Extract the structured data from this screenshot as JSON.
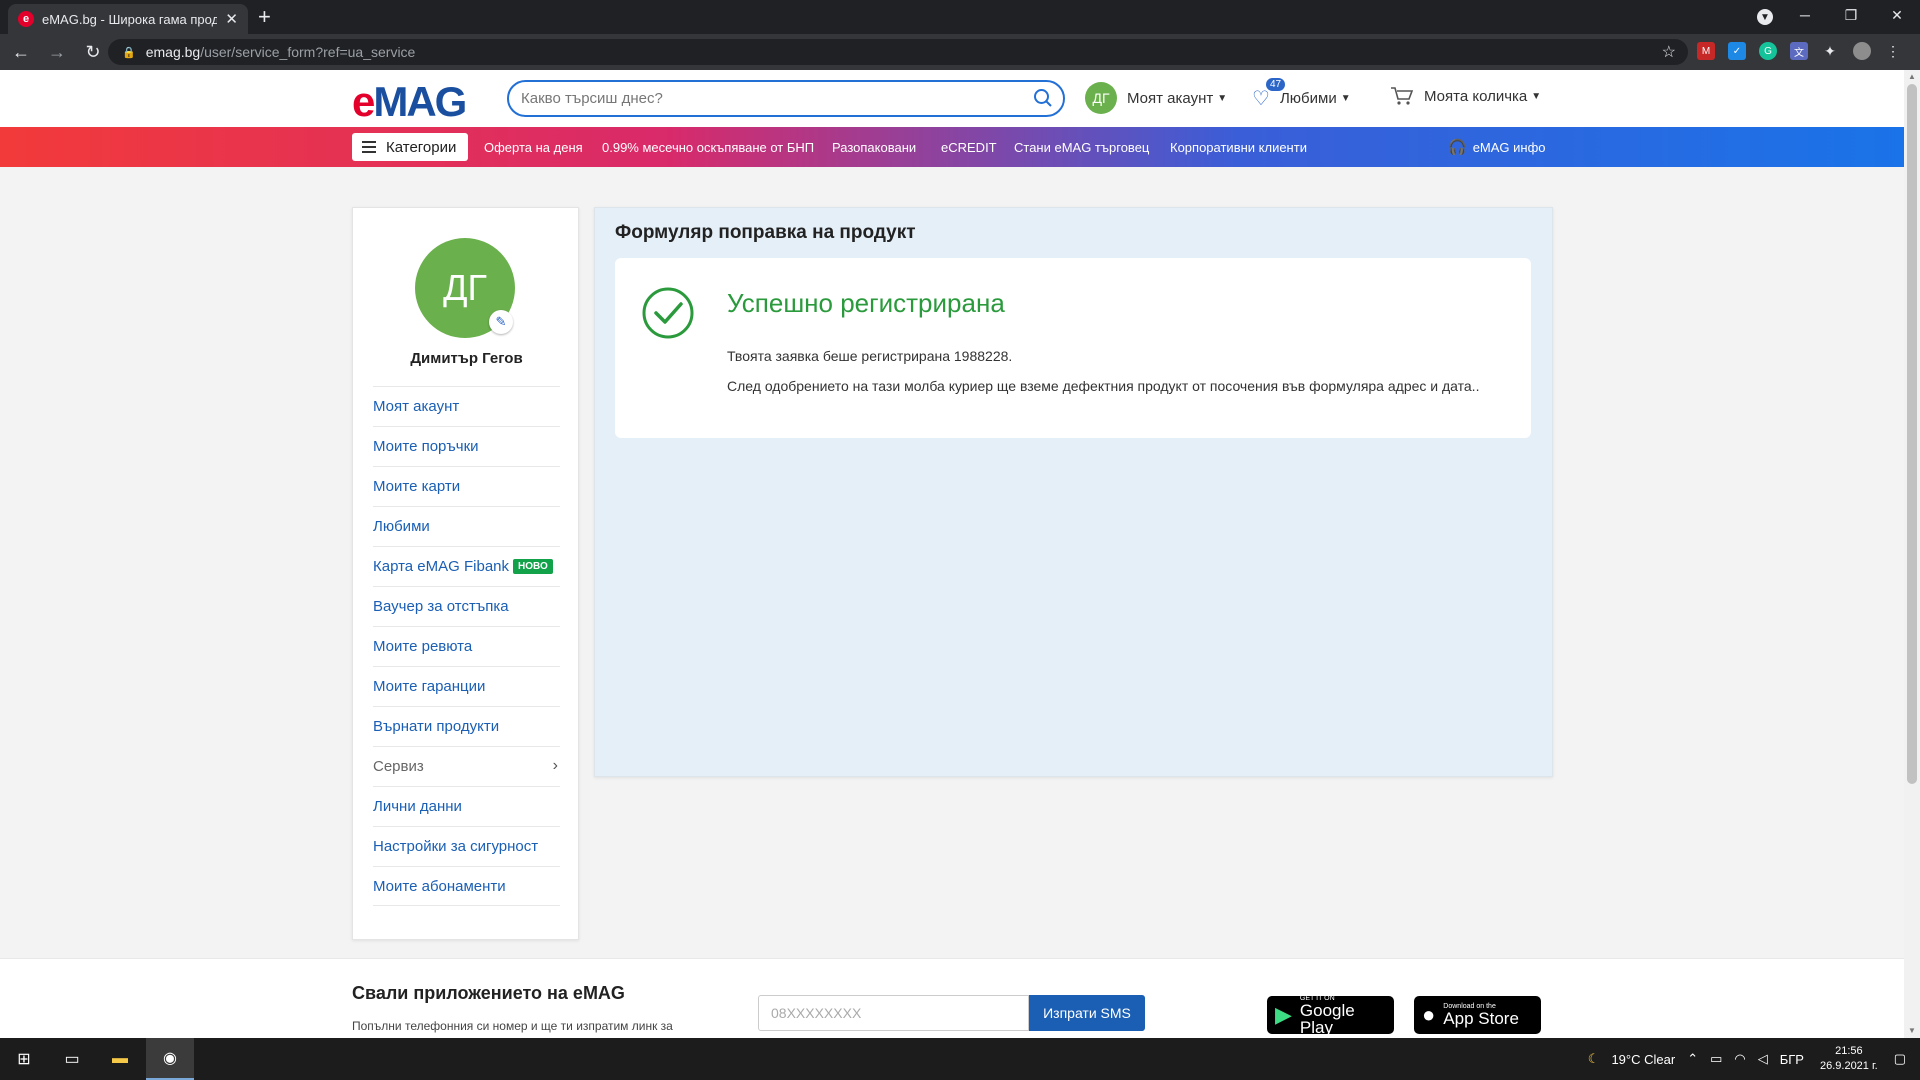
{
  "browser": {
    "tab_title": "eMAG.bg - Широка гама проду",
    "tab_favicon": "e",
    "new_tab_symbol": "+",
    "url_host": "emag.bg",
    "url_path": "/user/service_form?ref=ua_service"
  },
  "header": {
    "logo_e": "e",
    "logo_rest": "MAG",
    "search_placeholder": "Какво търсиш днес?",
    "account_initials": "ДГ",
    "account_label": "Моят акаунт",
    "favorites_label": "Любими",
    "favorites_count": "47",
    "cart_label": "Моята количка"
  },
  "navbar": {
    "categories": "Категории",
    "links": [
      "Оферта на деня",
      "0.99% месечно оскъпяване от БНП",
      "Разопаковани",
      "eCREDIT",
      "Стани eMAG търговец",
      "Корпоративни клиенти"
    ],
    "info": "eMAG инфо"
  },
  "sidebar": {
    "initials": "ДГ",
    "user_name": "Димитър Гегов",
    "items": [
      {
        "label": "Моят акаунт"
      },
      {
        "label": "Моите поръчки"
      },
      {
        "label": "Моите карти"
      },
      {
        "label": "Любими"
      },
      {
        "label": "Карта eMAG Fibank",
        "badge": "НОВО"
      },
      {
        "label": "Ваучер за отстъпка"
      },
      {
        "label": "Моите ревюта"
      },
      {
        "label": "Моите гаранции"
      },
      {
        "label": "Върнати продукти"
      },
      {
        "label": "Сервиз"
      },
      {
        "label": "Лични данни"
      },
      {
        "label": "Настройки за сигурност"
      },
      {
        "label": "Моите абонаменти"
      }
    ]
  },
  "main": {
    "title": "Формуляр поправка на продукт",
    "success_title": "Успешно регистрирана",
    "message1": "Твоята заявка беше регистрирана 1988228.",
    "message2": "След одобрението на тази молба куриер ще вземе дефектния продукт от посочения във формуляра адрес и дата.."
  },
  "footer": {
    "title": "Свали приложението на eMAG",
    "subtitle": "Попълни телефонния си номер и ще ти изпратим линк за",
    "phone_placeholder": "08XXXXXXXX",
    "sms_button": "Изпрати SMS",
    "google_small": "GET IT ON",
    "google_big": "Google Play",
    "apple_small": "Download on the",
    "apple_big": "App Store"
  },
  "taskbar": {
    "weather": "19°C  Clear",
    "lang": "БГР",
    "time": "21:56",
    "date": "26.9.2021 г."
  },
  "colors": {
    "brand_red": "#e3002b",
    "brand_blue": "#1a5fb4",
    "success_green": "#2a9a3c",
    "badge_green": "#12a24a"
  }
}
